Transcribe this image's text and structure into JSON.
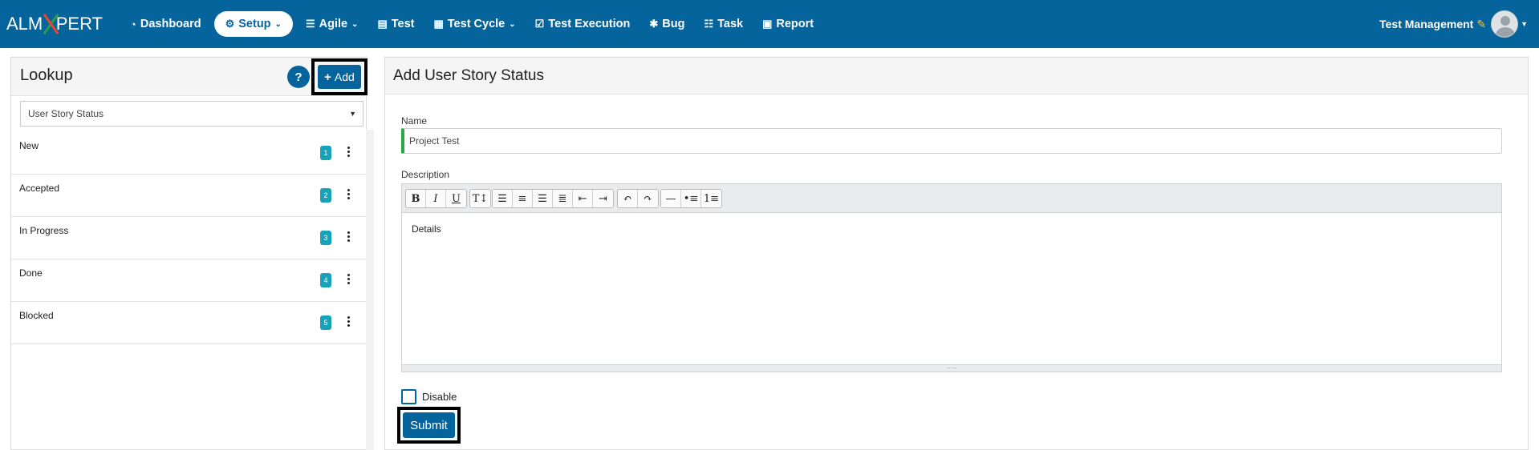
{
  "nav": {
    "logo_left": "ALM",
    "logo_right": "PERT",
    "items": [
      {
        "label": "Dashboard",
        "icon": "dashboard-icon",
        "glyph": "◔",
        "dropdown": false
      },
      {
        "label": "Setup",
        "icon": "cogs-icon",
        "glyph": "⚙",
        "dropdown": true,
        "active": true
      },
      {
        "label": "Agile",
        "icon": "list-icon",
        "glyph": "☰",
        "dropdown": true
      },
      {
        "label": "Test",
        "icon": "file-icon",
        "glyph": "▤",
        "dropdown": false
      },
      {
        "label": "Test Cycle",
        "icon": "table-icon",
        "glyph": "▦",
        "dropdown": true
      },
      {
        "label": "Test Execution",
        "icon": "check-square-icon",
        "glyph": "☑",
        "dropdown": false
      },
      {
        "label": "Bug",
        "icon": "bug-icon",
        "glyph": "✱",
        "dropdown": false
      },
      {
        "label": "Task",
        "icon": "tasks-icon",
        "glyph": "☷",
        "dropdown": false
      },
      {
        "label": "Report",
        "icon": "report-icon",
        "glyph": "▣",
        "dropdown": false
      }
    ],
    "user_label": "Test Management"
  },
  "lookup": {
    "title": "Lookup",
    "help_glyph": "?",
    "add_label": "Add",
    "select_value": "User Story Status",
    "items": [
      {
        "label": "New",
        "count": "1"
      },
      {
        "label": "Accepted",
        "count": "2"
      },
      {
        "label": "In Progress",
        "count": "3"
      },
      {
        "label": "Done",
        "count": "4"
      },
      {
        "label": "Blocked",
        "count": "5"
      }
    ]
  },
  "form": {
    "title": "Add User Story Status",
    "name_label": "Name",
    "name_value": "Project Test",
    "description_label": "Description",
    "description_value": "Details",
    "disable_label": "Disable",
    "submit_label": "Submit"
  },
  "colors": {
    "brand": "#04649b",
    "badge": "#17a2b8",
    "valid": "#28a745"
  }
}
